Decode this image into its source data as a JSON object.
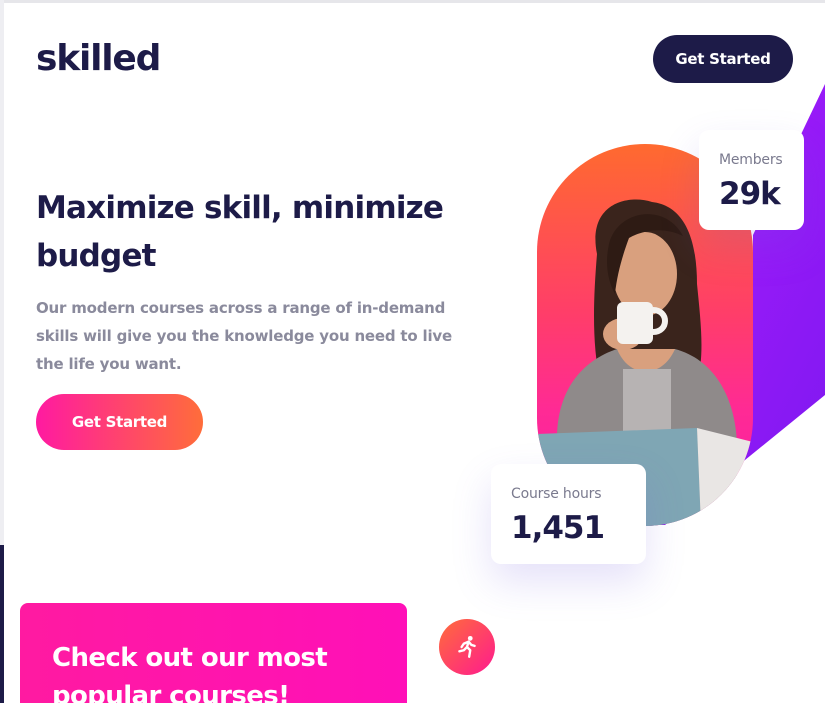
{
  "header": {
    "logo": "skilled",
    "cta_label": "Get Started"
  },
  "hero": {
    "title": "Maximize skill, minimize budget",
    "subtitle": "Our modern courses across a range of in-demand skills will give you the knowledge you need to live the life you want.",
    "cta_label": "Get Started"
  },
  "stats": {
    "members": {
      "label": "Members",
      "value": "29k"
    },
    "course_hours": {
      "label": "Course hours",
      "value": "1,451"
    }
  },
  "popular": {
    "title": "Check out our most popular courses!",
    "icon": "running-person-icon"
  },
  "colors": {
    "navy": "#1d1b48",
    "pink": "#ff1aa1",
    "orange": "#ff6d3a",
    "purple": "#a01cff",
    "muted_text": "#8a8a9c"
  }
}
